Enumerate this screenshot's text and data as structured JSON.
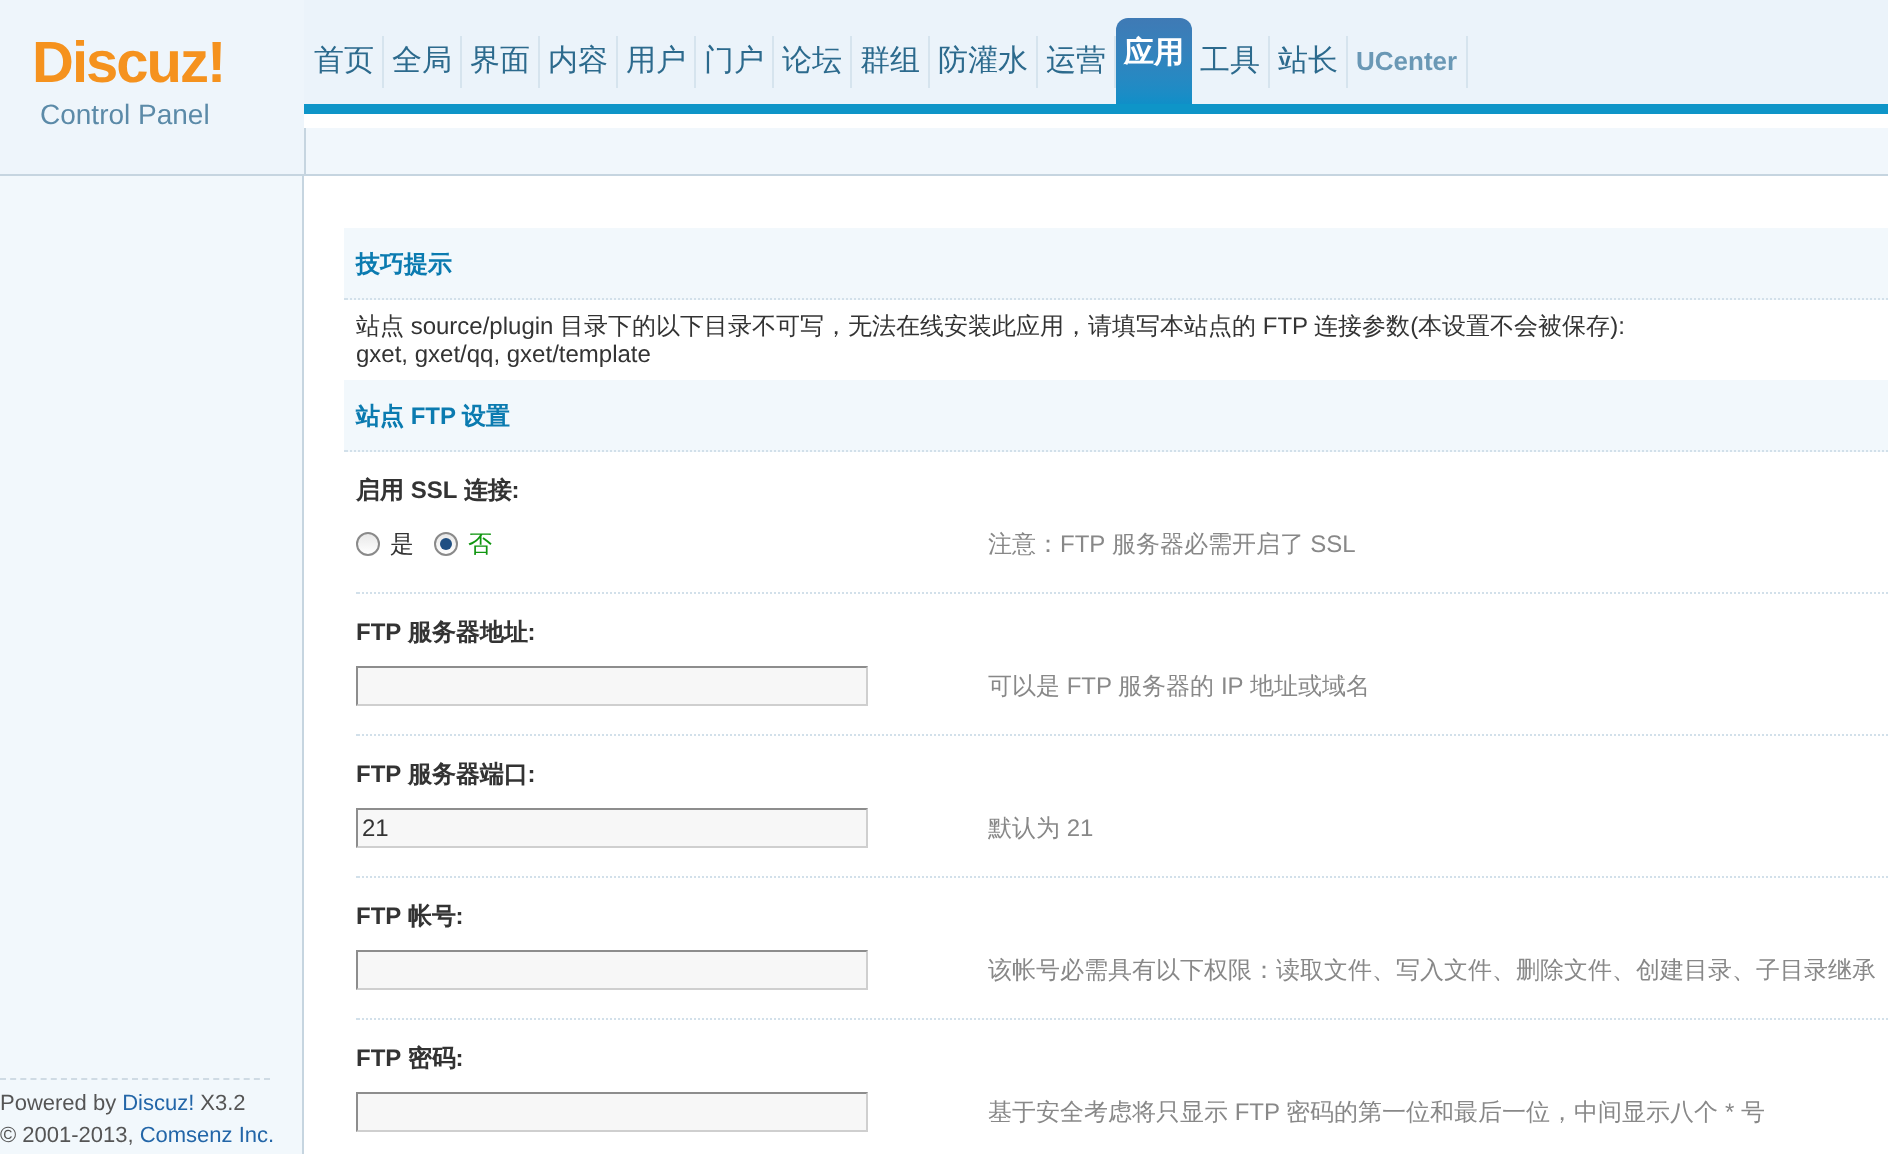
{
  "logo": {
    "brand": "Discuz!",
    "subtitle": "Control Panel"
  },
  "nav": [
    {
      "label": "首页",
      "selected": false,
      "kind": "menu"
    },
    {
      "label": "全局",
      "selected": false,
      "kind": "menu"
    },
    {
      "label": "界面",
      "selected": false,
      "kind": "menu"
    },
    {
      "label": "内容",
      "selected": false,
      "kind": "menu"
    },
    {
      "label": "用户",
      "selected": false,
      "kind": "menu"
    },
    {
      "label": "门户",
      "selected": false,
      "kind": "menu"
    },
    {
      "label": "论坛",
      "selected": false,
      "kind": "menu"
    },
    {
      "label": "群组",
      "selected": false,
      "kind": "menu"
    },
    {
      "label": "防灌水",
      "selected": false,
      "kind": "menu"
    },
    {
      "label": "运营",
      "selected": false,
      "kind": "menu"
    },
    {
      "label": "应用",
      "selected": true,
      "kind": "menu"
    },
    {
      "label": "工具",
      "selected": false,
      "kind": "menu"
    },
    {
      "label": "站长",
      "selected": false,
      "kind": "menu"
    },
    {
      "label": "UCenter",
      "selected": false,
      "kind": "external"
    }
  ],
  "tips": {
    "title": "技巧提示",
    "lines": [
      "站点 source/plugin 目录下的以下目录不可写，无法在线安装此应用，请填写本站点的 FTP 连接参数(本设置不会被保存):",
      "gxet, gxet/qq, gxet/template"
    ]
  },
  "section": {
    "title": "站点 FTP 设置"
  },
  "settings": [
    {
      "kind": "radio",
      "label": "启用 SSL 连接:",
      "options": [
        {
          "label": "是",
          "selected": false
        },
        {
          "label": "否",
          "selected": true
        }
      ],
      "hint": "注意：FTP 服务器必需开启了 SSL"
    },
    {
      "kind": "text",
      "label": "FTP 服务器地址:",
      "hint": "可以是 FTP 服务器的 IP 地址或域名"
    },
    {
      "kind": "text",
      "label": "FTP 服务器端口:",
      "value": "21",
      "hint": "默认为 21"
    },
    {
      "kind": "text",
      "label": "FTP 帐号:",
      "hint": "该帐号必需具有以下权限：读取文件、写入文件、删除文件、创建目录、子目录继承"
    },
    {
      "kind": "text",
      "label": "FTP 密码:",
      "hint": "基于安全考虑将只显示 FTP 密码的第一位和最后一位，中间显示八个 * 号"
    }
  ],
  "footer": {
    "powered": "Powered by",
    "brand": "Discuz!",
    "version": "X3.2",
    "copyright": "© 2001-2013,",
    "company": "Comsenz Inc."
  }
}
